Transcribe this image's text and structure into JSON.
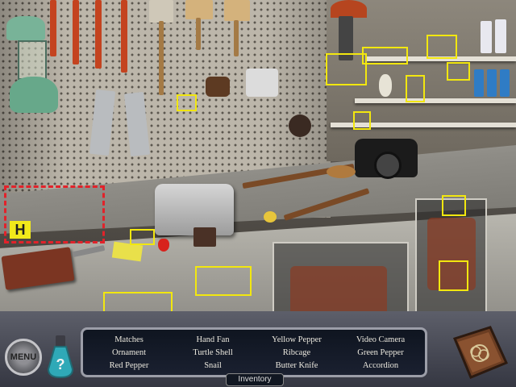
{
  "game": {
    "hint_marker_letter": "H",
    "menu_label": "MENU",
    "inventory_label": "Inventory"
  },
  "items": [
    "Matches",
    "Hand Fan",
    "Yellow Pepper",
    "Video Camera",
    "Ornament",
    "Turtle Shell",
    "Ribcage",
    "Green Pepper",
    "Red Pepper",
    "Snail",
    "Butter Knife",
    "Accordion"
  ],
  "colors": {
    "highlight": "#f2e70f",
    "hint_zone": "#e2222a",
    "hud_text": "#ece9df"
  },
  "icons": {
    "menu": "menu-gear-icon",
    "hint": "hint-potion-icon",
    "journal": "journal-book-icon"
  }
}
